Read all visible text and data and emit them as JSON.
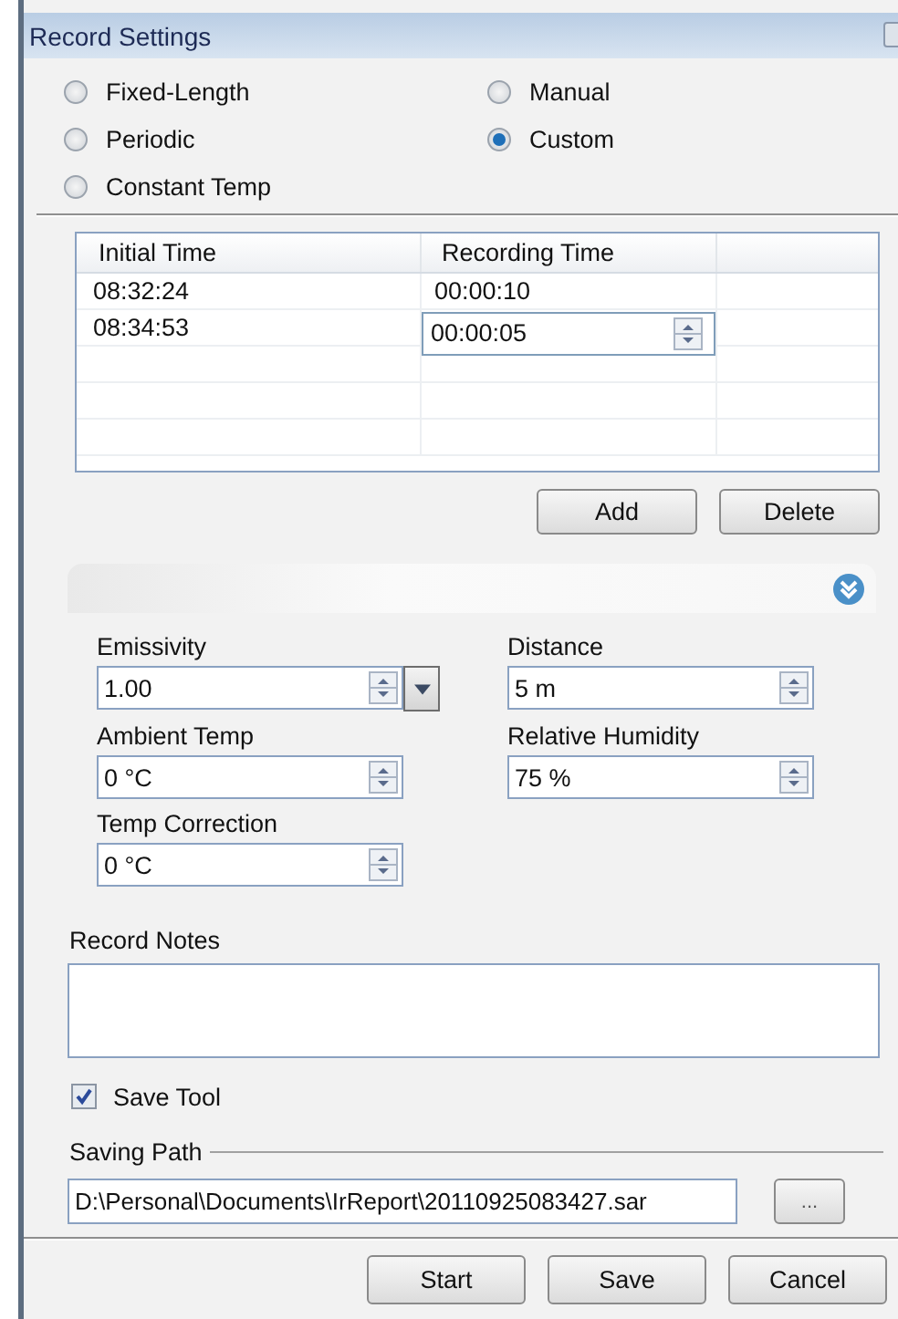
{
  "window": {
    "title": "Record Settings"
  },
  "modes": [
    {
      "label": "Fixed-Length",
      "selected": false
    },
    {
      "label": "Manual",
      "selected": false
    },
    {
      "label": "Periodic",
      "selected": false
    },
    {
      "label": "Custom",
      "selected": true
    },
    {
      "label": "Constant Temp",
      "selected": false
    }
  ],
  "table": {
    "columns": [
      "Initial Time",
      "Recording Time"
    ],
    "rows": [
      {
        "initial": "08:32:24",
        "recording": "00:00:10",
        "editing": false
      },
      {
        "initial": "08:34:53",
        "recording": "00:00:05",
        "editing": true
      }
    ]
  },
  "table_buttons": [
    "Add",
    "Delete"
  ],
  "params": [
    {
      "label": "Emissivity",
      "value": "1.00",
      "dropdown": true
    },
    {
      "label": "Distance",
      "value": "5 m",
      "dropdown": false
    },
    {
      "label": "Ambient Temp",
      "value": "0 °C",
      "dropdown": false
    },
    {
      "label": "Relative Humidity",
      "value": "75 %",
      "dropdown": false
    },
    {
      "label": "Temp Correction",
      "value": "0 °C",
      "dropdown": false
    }
  ],
  "notes": {
    "label": "Record Notes"
  },
  "save_tool": {
    "label": "Save Tool",
    "checked": true
  },
  "saving_path": {
    "label": "Saving Path",
    "value": "D:\\Personal\\Documents\\IrReport\\20110925083427.sar",
    "browse": "..."
  },
  "buttons": [
    "Start",
    "Save",
    "Cancel"
  ]
}
